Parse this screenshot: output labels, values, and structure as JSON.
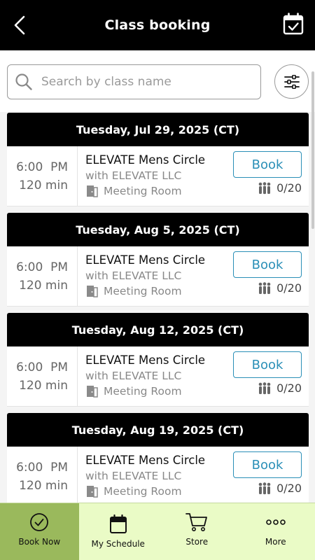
{
  "header": {
    "title": "Class booking",
    "back_icon": "chevron-left-icon",
    "calendar_icon": "calendar-check-icon"
  },
  "search": {
    "placeholder": "Search by class name",
    "value": "",
    "filter_icon": "sliders-icon"
  },
  "days": [
    {
      "date": "Tuesday, Jul 29, 2025 (CT)",
      "classes": [
        {
          "time": "6:00  PM",
          "duration": "120 min",
          "name": "ELEVATE Mens Circle",
          "instructor": "with ELEVATE LLC",
          "room": "Meeting Room",
          "book_label": "Book",
          "capacity": "0/20"
        }
      ]
    },
    {
      "date": "Tuesday, Aug 5, 2025 (CT)",
      "classes": [
        {
          "time": "6:00  PM",
          "duration": "120 min",
          "name": "ELEVATE Mens Circle",
          "instructor": "with ELEVATE LLC",
          "room": "Meeting Room",
          "book_label": "Book",
          "capacity": "0/20"
        }
      ]
    },
    {
      "date": "Tuesday, Aug 12, 2025 (CT)",
      "classes": [
        {
          "time": "6:00  PM",
          "duration": "120 min",
          "name": "ELEVATE Mens Circle",
          "instructor": "with ELEVATE LLC",
          "room": "Meeting Room",
          "book_label": "Book",
          "capacity": "0/20"
        }
      ]
    },
    {
      "date": "Tuesday, Aug 19, 2025 (CT)",
      "classes": [
        {
          "time": "6:00  PM",
          "duration": "120 min",
          "name": "ELEVATE Mens Circle",
          "instructor": "with ELEVATE LLC",
          "room": "Meeting Room",
          "book_label": "Book",
          "capacity": "0/20"
        }
      ]
    }
  ],
  "bottom_nav": [
    {
      "label": "Book Now",
      "icon": "check-circle-icon",
      "active": true
    },
    {
      "label": "My Schedule",
      "icon": "calendar-icon",
      "active": false
    },
    {
      "label": "Store",
      "icon": "cart-icon",
      "active": false
    },
    {
      "label": "More",
      "icon": "more-dots-icon",
      "active": false
    }
  ],
  "colors": {
    "header_bg": "#000000",
    "accent": "#2a8fb7",
    "nav_bg": "#eafbc6",
    "nav_active_bg": "#9ab95c"
  }
}
